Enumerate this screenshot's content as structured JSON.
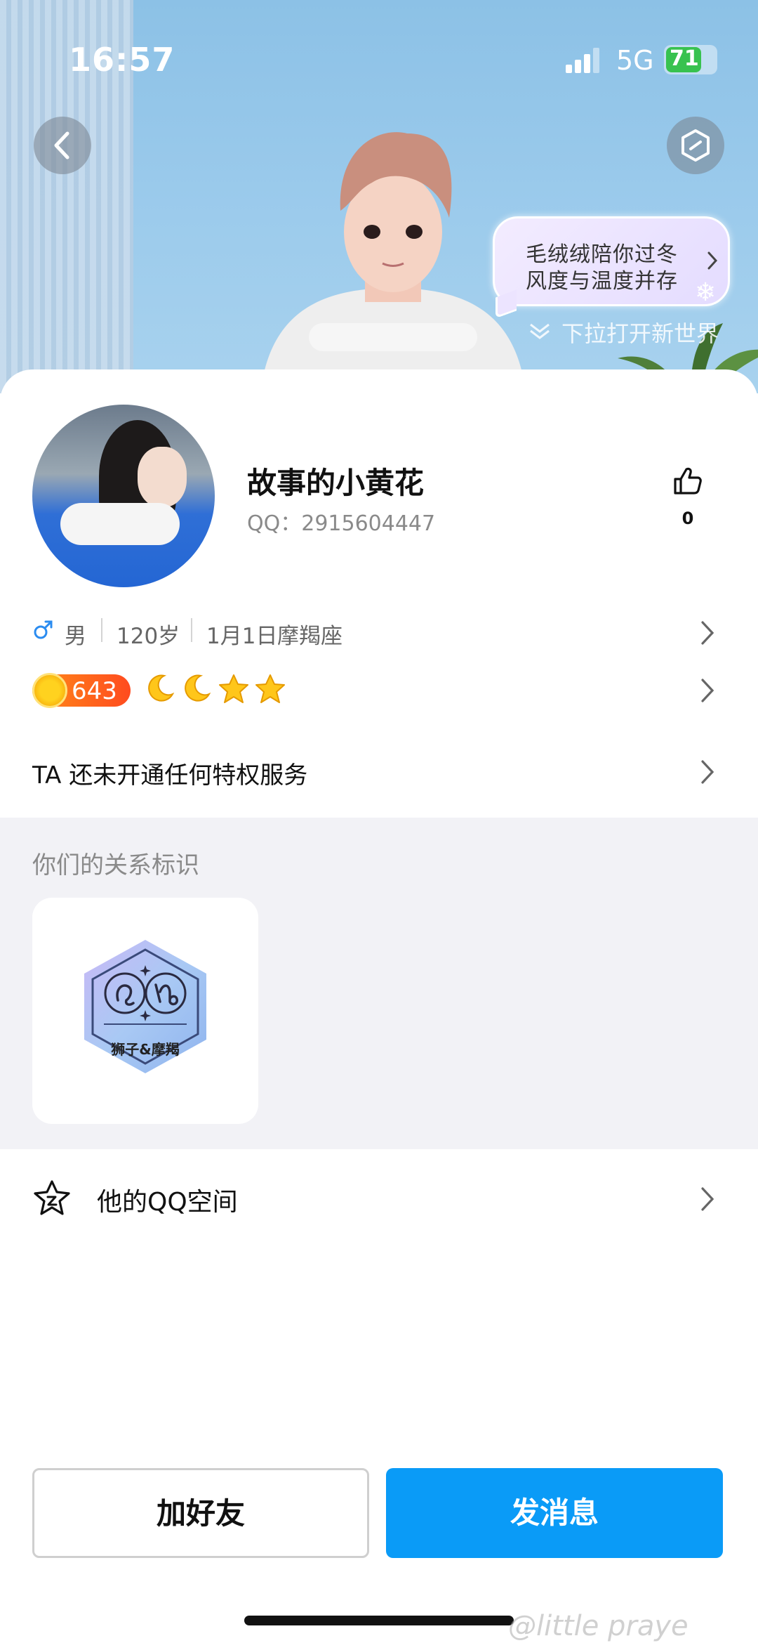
{
  "status_bar": {
    "time": "16:57",
    "network": "5G",
    "battery": "71",
    "battery_level": 0.71,
    "battery_color": "#38c24f"
  },
  "hero": {
    "bubble_line1": "毛绒绒陪你过冬",
    "bubble_line2": "风度与温度并存",
    "pull_hint": "下拉打开新世界"
  },
  "profile": {
    "nickname": "故事的小黄花",
    "qq_label": "QQ：2915604447",
    "likes": "0",
    "gender": "男",
    "age": "120岁",
    "birthday": "1月1日",
    "zodiac": "摩羯座",
    "level": "643",
    "level_icons": [
      "moon-icon",
      "moon-icon",
      "star-icon",
      "star-icon"
    ],
    "privilege_text": "TA 还未开通任何特权服务"
  },
  "relation": {
    "title": "你们的关系标识",
    "badge_label": "狮子&摩羯"
  },
  "qzone": {
    "label": "他的QQ空间"
  },
  "actions": {
    "add_friend": "加好友",
    "send_message": "发消息"
  },
  "watermark": "@little praye",
  "colors": {
    "primary_button": "#0a9bf7",
    "level_badge": "#ff5a1f",
    "male_icon": "#2b8cf0"
  }
}
